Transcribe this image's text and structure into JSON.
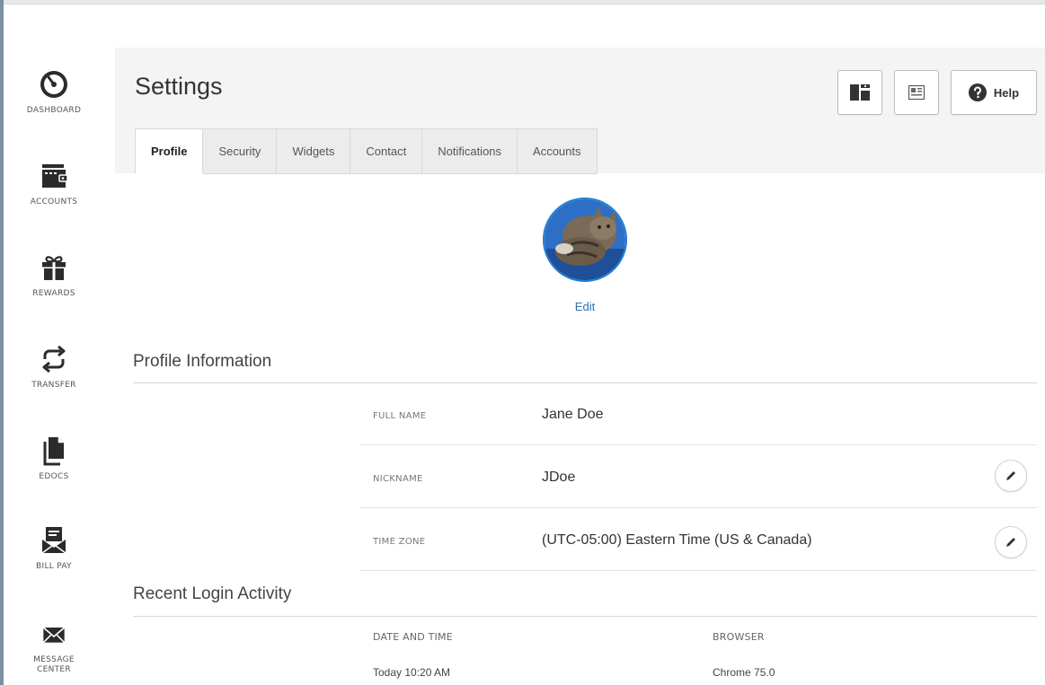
{
  "sidebar": {
    "items": [
      {
        "label": "DASHBOARD",
        "icon": "dashboard-gauge-icon"
      },
      {
        "label": "ACCOUNTS",
        "icon": "wallet-icon"
      },
      {
        "label": "REWARDS",
        "icon": "gift-icon"
      },
      {
        "label": "TRANSFER",
        "icon": "transfer-arrows-icon"
      },
      {
        "label": "EDOCS",
        "icon": "document-icon"
      },
      {
        "label": "BILL PAY",
        "icon": "bill-pay-icon"
      },
      {
        "label": "MESSAGE CENTER",
        "icon": "envelope-icon"
      }
    ]
  },
  "header": {
    "title": "Settings",
    "help_label": "Help",
    "buttons": [
      "layout-icon",
      "widget-card-icon",
      "help-circle-icon"
    ]
  },
  "tabs": [
    {
      "label": "Profile",
      "active": true
    },
    {
      "label": "Security",
      "active": false
    },
    {
      "label": "Widgets",
      "active": false
    },
    {
      "label": "Contact",
      "active": false
    },
    {
      "label": "Notifications",
      "active": false
    },
    {
      "label": "Accounts",
      "active": false
    }
  ],
  "profile": {
    "edit_label": "Edit",
    "section_title": "Profile Information",
    "fields": [
      {
        "label": "FULL NAME",
        "value": "Jane Doe",
        "editable": false
      },
      {
        "label": "NICKNAME",
        "value": "JDoe",
        "editable": true
      },
      {
        "label": "TIME ZONE",
        "value": "(UTC-05:00) Eastern Time (US & Canada)",
        "editable": true
      }
    ]
  },
  "login_activity": {
    "section_title": "Recent Login Activity",
    "columns": [
      "DATE AND TIME",
      "BROWSER"
    ],
    "rows": [
      {
        "date": "Today 10:20 AM",
        "browser": "Chrome 75.0"
      }
    ]
  },
  "colors": {
    "accent": "#2f6fb0",
    "avatar_ring": "#1e7fd6",
    "icon": "#2b2b2b"
  }
}
